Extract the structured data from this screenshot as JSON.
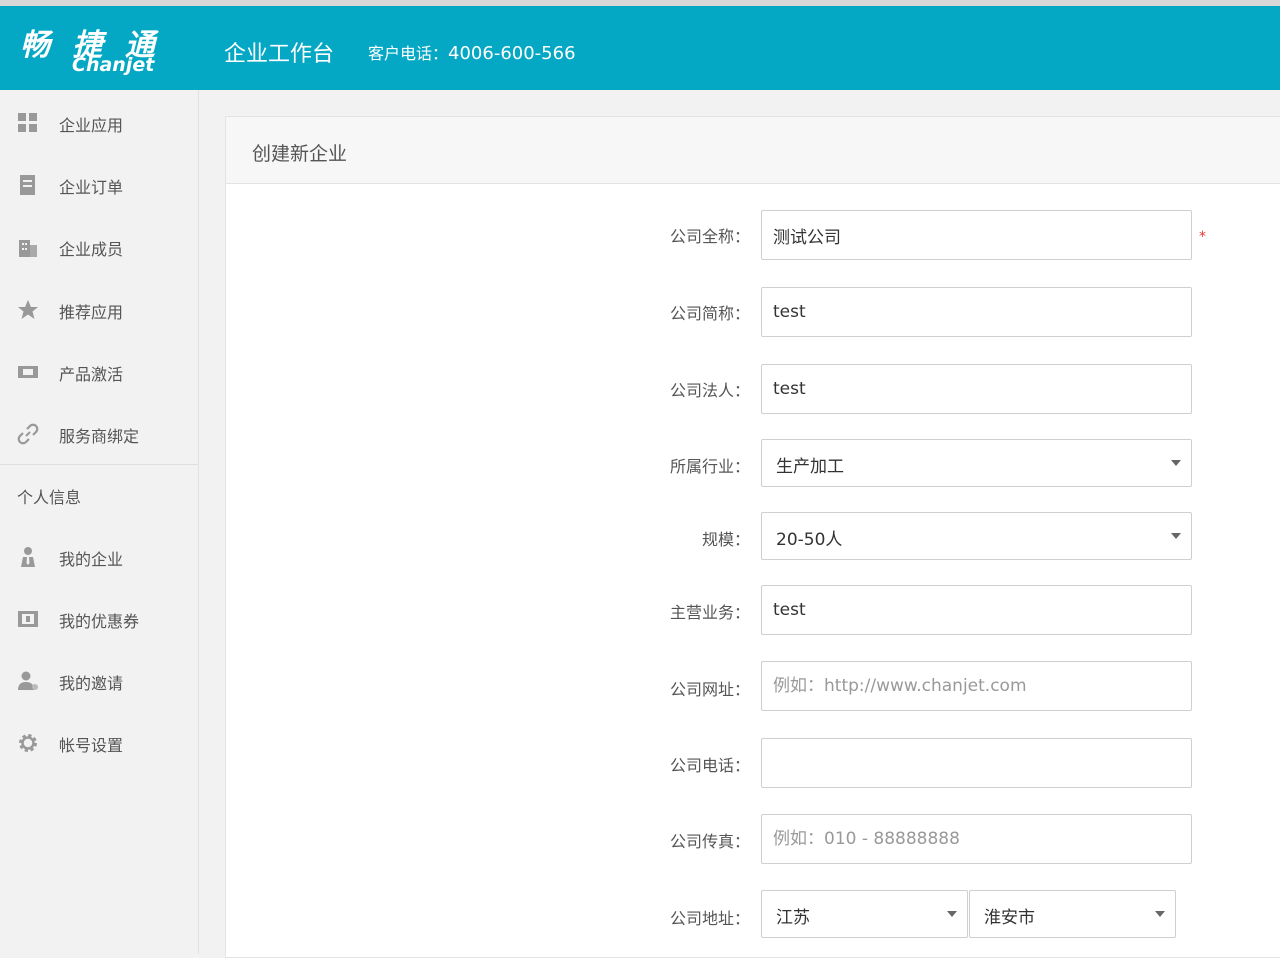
{
  "header": {
    "logo_cn": "畅 捷 通",
    "logo_en": "Chanjet",
    "title": "企业工作台",
    "phone_label": "客户电话：",
    "phone_number": "4006-600-566"
  },
  "sidebar": {
    "items": [
      {
        "label": "企业应用",
        "icon": "apps-grid-icon"
      },
      {
        "label": "企业订单",
        "icon": "order-document-icon"
      },
      {
        "label": "企业成员",
        "icon": "building-icon"
      },
      {
        "label": "推荐应用",
        "icon": "star-icon"
      },
      {
        "label": "产品激活",
        "icon": "ticket-icon"
      },
      {
        "label": "服务商绑定",
        "icon": "link-icon"
      }
    ],
    "section_title": "个人信息",
    "personal_items": [
      {
        "label": "我的企业",
        "icon": "person-tie-icon"
      },
      {
        "label": "我的优惠券",
        "icon": "coupon-icon"
      },
      {
        "label": "我的邀请",
        "icon": "user-invite-icon"
      },
      {
        "label": "帐号设置",
        "icon": "gear-icon"
      }
    ]
  },
  "form": {
    "title": "创建新企业",
    "required_mark": "*",
    "fields": {
      "full_name": {
        "label": "公司全称：",
        "value": "测试公司"
      },
      "short_name": {
        "label": "公司简称：",
        "value": "test"
      },
      "legal_person": {
        "label": "公司法人：",
        "value": "test"
      },
      "industry": {
        "label": "所属行业：",
        "value": "生产加工"
      },
      "scale": {
        "label": "规模：",
        "value": "20-50人"
      },
      "main_business": {
        "label": "主营业务：",
        "value": "test"
      },
      "website": {
        "label": "公司网址：",
        "value": "",
        "placeholder": "例如：http://www.chanjet.com"
      },
      "phone": {
        "label": "公司电话：",
        "value": ""
      },
      "fax": {
        "label": "公司传真：",
        "value": "",
        "placeholder": "例如：010 - 88888888"
      },
      "address": {
        "label": "公司地址：",
        "province": "江苏",
        "city": "淮安市"
      }
    }
  },
  "colors": {
    "header_bg": "#05a8c4",
    "required": "#e33333"
  }
}
